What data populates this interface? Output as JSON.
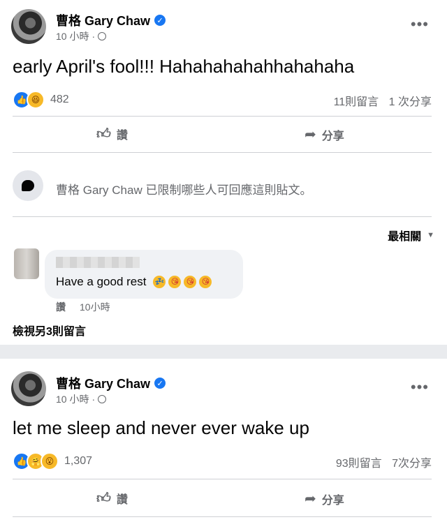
{
  "posts": [
    {
      "author": "曹格 Gary Chaw",
      "time": "10 小時",
      "dot": "·",
      "text": "early April's fool!!! Hahahahahahhahahaha",
      "reactions": [
        "like",
        "haha"
      ],
      "reaction_count": "482",
      "comments": "11則留言",
      "shares": "1 次分享",
      "like_label": "讚",
      "share_label": "分享"
    },
    {
      "author": "曹格 Gary Chaw",
      "time": "10 小時",
      "dot": "·",
      "text": "let me sleep and never ever wake up",
      "reactions": [
        "like",
        "care",
        "wow"
      ],
      "reaction_count": "1,307",
      "comments": "93則留言",
      "shares": "7次分享",
      "like_label": "讚",
      "share_label": "分享"
    }
  ],
  "restriction_notice": "曹格 Gary Chaw 已限制哪些人可回應這則貼文。",
  "sort_label": "最相關",
  "comment": {
    "text": "Have a good rest",
    "emojis": [
      "sleepy-face",
      "kissing-face",
      "kissing-face",
      "kissing-face"
    ],
    "like_label": "讚",
    "time": "10小時"
  },
  "view_more_comments": "檢視另3則留言",
  "more_glyph": "•••",
  "colors": {
    "accent": "#1877f2",
    "secondary_text": "#65676b",
    "divider": "#ced0d4"
  },
  "icons": [
    "verified-badge-icon",
    "globe-icon",
    "more-icon",
    "like-thumb-icon",
    "share-arrow-icon",
    "comment-bubble-icon",
    "caret-down-icon"
  ]
}
